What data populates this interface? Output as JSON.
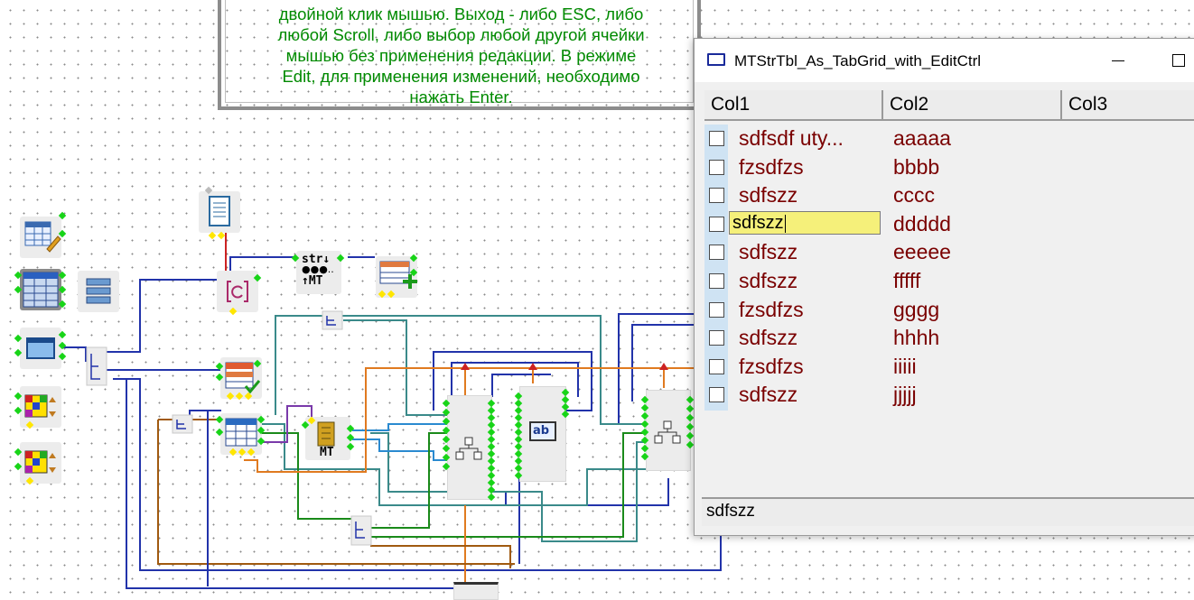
{
  "note": {
    "text": "двойной клик мышью. Выход - либо ESC, либо\nлюбой Scroll, либо выбор любой другой ячейки\nмышью без применения редакции. В режиме\nEdit, для применения изменений, необходимо\nнажать Enter."
  },
  "window": {
    "title": "MTStrTbl_As_TabGrid_with_EditCtrl",
    "columns": [
      "Col1",
      "Col2",
      "Col3"
    ],
    "rows": [
      {
        "col1": "sdfsdf uty...",
        "col2": "aaaaa"
      },
      {
        "col1": "fzsdfzs",
        "col2": "bbbb"
      },
      {
        "col1": "sdfszz",
        "col2": "cccc"
      },
      {
        "col1": "sdfszz",
        "col2": "ddddd",
        "editing": true
      },
      {
        "col1": "sdfszz",
        "col2": "eeeee"
      },
      {
        "col1": "sdfszz",
        "col2": "fffff"
      },
      {
        "col1": "fzsdfzs",
        "col2": "gggg"
      },
      {
        "col1": "sdfszz",
        "col2": "hhhh"
      },
      {
        "col1": "fzsdfzs",
        "col2": "iiiii"
      },
      {
        "col1": "sdfszz",
        "col2": "jjjjj"
      }
    ],
    "edit_value": "sdfszz",
    "status_text": "sdfszz",
    "colors": {
      "cell_text": "#7a0000",
      "edit_bg": "#f5f07a",
      "selection_strip": "#cfe3f3"
    }
  },
  "blocks": {
    "str_label": "str↓",
    "mt_label": "↑MT",
    "mt2_label": "MT",
    "ab_label": "ab"
  }
}
